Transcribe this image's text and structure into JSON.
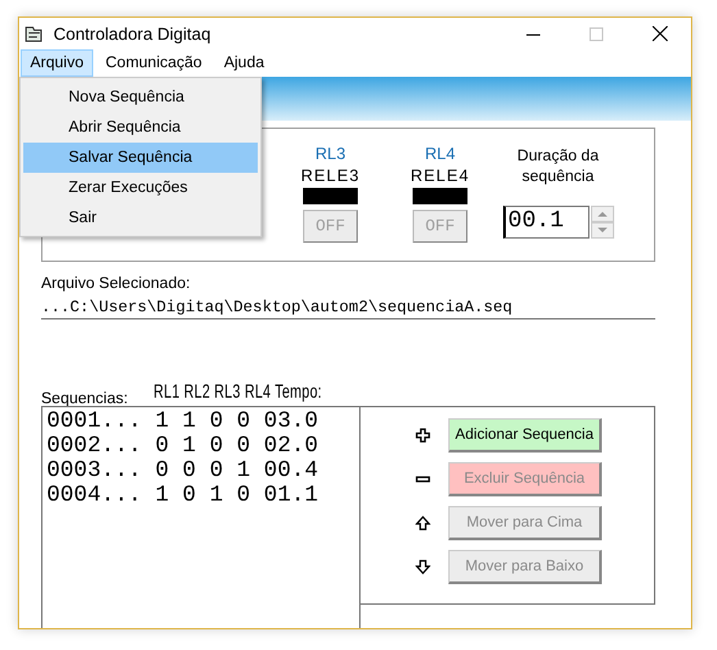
{
  "window": {
    "title": "Controladora Digitaq"
  },
  "menu_bar": [
    {
      "label": "Arquivo",
      "selected": true
    },
    {
      "label": "Comunicação",
      "selected": false
    },
    {
      "label": "Ajuda",
      "selected": false
    }
  ],
  "menu": [
    {
      "label": "Nova Sequência",
      "selected": false
    },
    {
      "label": "Abrir Sequência",
      "selected": false
    },
    {
      "label": "Salvar Sequência",
      "selected": true
    },
    {
      "label": "Zerar Execuções",
      "selected": false
    },
    {
      "label": "Sair",
      "selected": false
    }
  ],
  "relays": [
    {
      "name": "RL3",
      "label": "RELE3",
      "on": false,
      "button": "OFF"
    },
    {
      "name": "RL4",
      "label": "RELE4",
      "on": false,
      "button": "OFF"
    }
  ],
  "duration": {
    "label": "Duração da sequência",
    "value": "00.1"
  },
  "selected_file": {
    "label": "Arquivo Selecionado:",
    "path": "...C:\\Users\\Digitaq\\Desktop\\autom2\\sequenciaA.seq"
  },
  "sequences": {
    "label": "Sequencias:",
    "header": "RL1 RL2 RL3 RL4 Tempo:",
    "rows": [
      "0001... 1 1 0 0 03.0",
      "0002... 0 1 0 0 02.0",
      "0003... 0 0 0 1 00.4",
      "0004... 1 0 1 0 01.1"
    ]
  },
  "actions": [
    {
      "kind": "add",
      "label": "Adicionar Sequencia",
      "disabled": false,
      "color": "#c6f7c6"
    },
    {
      "kind": "remove",
      "label": "Excluir Sequência",
      "disabled": true,
      "color": "#ffc0c0"
    },
    {
      "kind": "up",
      "label": "Mover para Cima",
      "disabled": true,
      "color": "#ececec"
    },
    {
      "kind": "down",
      "label": "Mover para Baixo",
      "disabled": true,
      "color": "#ececec"
    }
  ]
}
